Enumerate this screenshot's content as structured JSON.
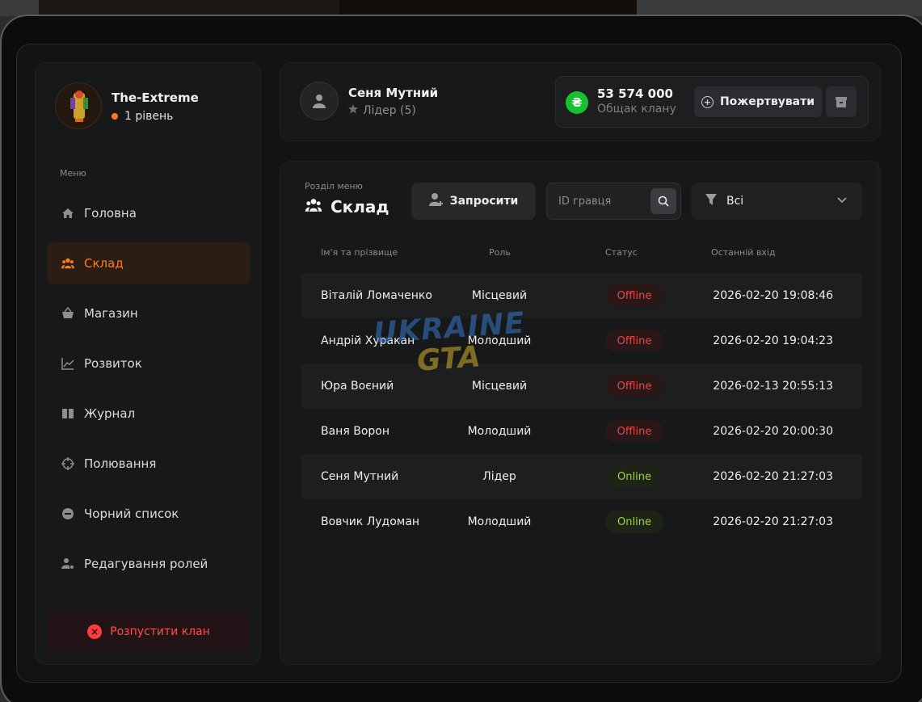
{
  "clan": {
    "name": "The-Extreme",
    "level": "1 рівень"
  },
  "menu": {
    "caption": "Меню",
    "items": [
      {
        "label": "Головна",
        "icon": "home-icon",
        "active": false
      },
      {
        "label": "Склад",
        "icon": "users-icon",
        "active": true
      },
      {
        "label": "Магазин",
        "icon": "basket-icon",
        "active": false
      },
      {
        "label": "Розвиток",
        "icon": "chart-icon",
        "active": false
      },
      {
        "label": "Журнал",
        "icon": "book-icon",
        "active": false
      },
      {
        "label": "Полювання",
        "icon": "crosshair-icon",
        "active": false
      },
      {
        "label": "Чорний список",
        "icon": "minus-circle-icon",
        "active": false
      },
      {
        "label": "Редагування ролей",
        "icon": "user-gear-icon",
        "active": false
      }
    ],
    "disband_label": "Розпустити клан"
  },
  "user": {
    "name": "Сеня Мутний",
    "role": "Лідер (5)"
  },
  "bank": {
    "amount": "53 574 000",
    "label": "Общак клану",
    "donate_label": "Пожертвувати",
    "currency_symbol": "₴"
  },
  "section": {
    "caption": "Розділ меню",
    "title": "Склад",
    "invite_label": "Запросити",
    "search_placeholder": "ID гравця",
    "filter_value": "Всі"
  },
  "table": {
    "headers": {
      "name": "Ім'я та прізвище",
      "role": "Роль",
      "status": "Статус",
      "last_login": "Останній вхід"
    },
    "rows": [
      {
        "name": "Віталій Ломаченко",
        "role": "Місцевий",
        "status": "Offline",
        "last_login": "2026-02-20 19:08:46"
      },
      {
        "name": "Андрій Хуракан",
        "role": "Молодший",
        "status": "Offline",
        "last_login": "2026-02-20 19:04:23"
      },
      {
        "name": "Юра Воєний",
        "role": "Місцевий",
        "status": "Offline",
        "last_login": "2026-02-13 20:55:13"
      },
      {
        "name": "Ваня Ворон",
        "role": "Молодший",
        "status": "Offline",
        "last_login": "2026-02-20 20:00:30"
      },
      {
        "name": "Сеня Мутний",
        "role": "Лідер",
        "status": "Online",
        "last_login": "2026-02-20 21:27:03"
      },
      {
        "name": "Вовчик Лудоман",
        "role": "Молодший",
        "status": "Online",
        "last_login": "2026-02-20 21:27:03"
      }
    ]
  },
  "watermark": {
    "line1": "UKRAINE",
    "line2": "GTA"
  },
  "colors": {
    "accent": "#ff7a1a",
    "online": "#9ed637",
    "offline": "#e04a4a",
    "danger": "#ff3b3b",
    "currency": "#16c02e"
  }
}
